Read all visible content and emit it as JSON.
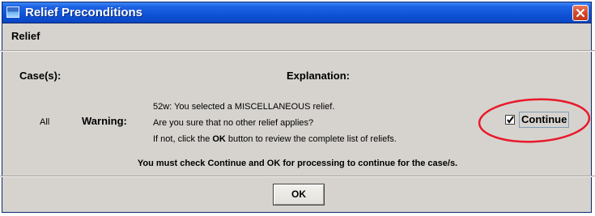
{
  "window": {
    "title": "Relief Preconditions"
  },
  "section": {
    "title": "Relief"
  },
  "columns": {
    "cases": "Case(s):",
    "explanation": "Explanation:"
  },
  "row": {
    "case": "All",
    "severity": "Warning:",
    "explanation_line1": "52w: You selected a MISCELLANEOUS relief.",
    "explanation_line2": "Are you sure that no other relief applies?",
    "explanation_line3_pre": "If not, click the ",
    "explanation_line3_bold": "OK",
    "explanation_line3_post": " button to review the complete list of reliefs.",
    "continue_label": "Continue",
    "continue_checked": true
  },
  "instruction": "You must check Continue and OK for processing to continue for the case/s.",
  "buttons": {
    "ok_label": "OK"
  },
  "colors": {
    "annotation_ellipse": "#e8192c",
    "titlebar": "#0f53d6",
    "dialog_bg": "#d6d3ce"
  }
}
